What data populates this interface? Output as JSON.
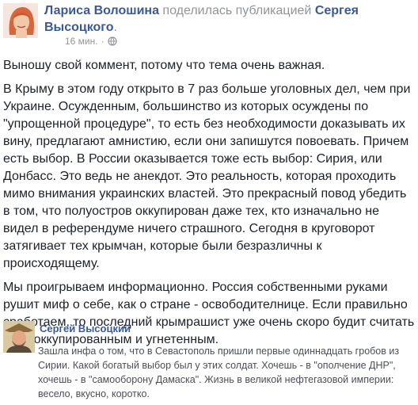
{
  "header": {
    "author_name": "Лариса Волошина",
    "action": " поделилась публикацией ",
    "target_name": "Сергея Высоцкого",
    "target_suffix": ".",
    "time": "16 мин.",
    "separator": "·",
    "privacy_icon": "globe-icon"
  },
  "post": {
    "paragraphs": [
      "Выношу свой коммент, потому что тема очень важная.",
      "В Крыму в этом году открыто в 7 раз больше уголовных дел, чем при Украине. Осужденным, большинство из которых осуждены по \"упрощенной процедуре\", то есть без необходимости доказывать их вину, предлагают амнистию, если они запишутся повоевать. Причем есть выбор. В России оказывается тоже есть выбор: Сирия, или Донбасс. Это ведь не анекдот. Это реальность, которая проходить мимо внимания украинских властей. Это прекрасный повод убедить в том, что полуостров оккупирован даже тех, кто изначально не видел в референдуме ничего страшного. Сегодня в круговорот затягивает тех крымчан, которые были безразличны к происходящему.",
      "Мы проигрываем информационно. Россия собственными руками рушит миф о себе, как о стране - освободителнице. Если правильно сработаем, то последний крымрашист уже очень скоро будит считать себя оккупированным и угнетенным."
    ]
  },
  "shared": {
    "author_name": "Сергей Высоцкий",
    "text": "Зашла инфа о том, что в Севастополь пришли первые одиннадцать гробов из Сирии. Какой богатый выбор был у этих солдат. Хочешь - в \"ополчение ДНР\", хочешь - в \"самооборону Дамаска\". Жизнь в великой нефтегазовой империи: весело, вкусно, коротко."
  },
  "colors": {
    "link": "#3b5998",
    "meta": "#90949c",
    "text": "#1d2129",
    "shared_text": "#4b4f56"
  }
}
